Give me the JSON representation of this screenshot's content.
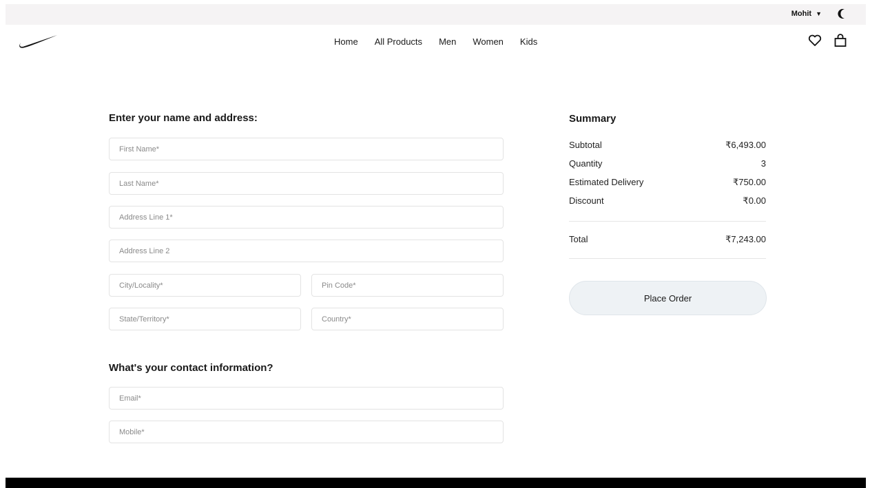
{
  "header": {
    "user_name": "Mohit",
    "nav": [
      "Home",
      "All Products",
      "Men",
      "Women",
      "Kids"
    ]
  },
  "address_form": {
    "title": "Enter your name and address:",
    "fields": {
      "first_name": "First Name*",
      "last_name": "Last Name*",
      "address1": "Address Line 1*",
      "address2": "Address Line 2",
      "city": "City/Locality*",
      "pin": "Pin Code*",
      "state": "State/Territory*",
      "country": "Country*"
    }
  },
  "contact_form": {
    "title": "What's your contact information?",
    "fields": {
      "email": "Email*",
      "mobile": "Mobile*"
    }
  },
  "summary": {
    "title": "Summary",
    "rows": [
      {
        "label": "Subtotal",
        "value": "₹6,493.00"
      },
      {
        "label": "Quantity",
        "value": "3"
      },
      {
        "label": "Estimated Delivery",
        "value": "₹750.00"
      },
      {
        "label": "Discount",
        "value": "₹0.00"
      }
    ],
    "total_label": "Total",
    "total_value": "₹7,243.00",
    "button_label": "Place Order"
  },
  "colors": {
    "topbar_bg": "#f5f3f4",
    "button_bg": "#eef2f5",
    "footer_bg": "#000000"
  },
  "icons": [
    "moon-icon",
    "nike-logo",
    "heart-icon",
    "shopping-bag-icon",
    "caret-down-icon"
  ]
}
